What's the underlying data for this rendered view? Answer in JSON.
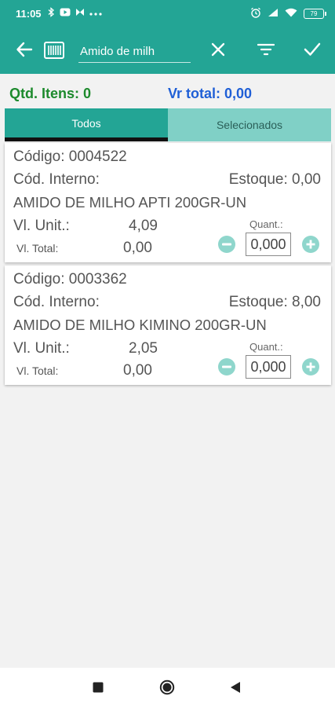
{
  "status_bar": {
    "time": "11:05",
    "left_icons": [
      "bluetooth-icon",
      "youtube-icon",
      "link-icon",
      "more-icon"
    ],
    "right_icons": [
      "alarm-icon",
      "signal-icon",
      "wifi-icon"
    ],
    "battery": "79"
  },
  "toolbar": {
    "search_value": "Amido de milh",
    "icons": [
      "back-arrow-icon",
      "barcode-icon",
      "clear-icon",
      "filter-icon",
      "check-icon"
    ],
    "background": "#23a595"
  },
  "summary": {
    "qtd_itens": "Qtd. Itens: 0",
    "vr_total": "Vr total: 0,00"
  },
  "tabs": [
    {
      "label": "Todos",
      "active": true
    },
    {
      "label": "Selecionados",
      "active": false
    }
  ],
  "products": [
    {
      "codigo": "Código: 0004522",
      "cod_interno": "Cód. Interno:",
      "estoque": "Estoque: 0,00",
      "descricao": "AMIDO DE MILHO APTI 200GR-UN",
      "vl_unit_label": "Vl. Unit.:",
      "vl_unit": "4,09",
      "vl_total_label": "Vl. Total:",
      "vl_total": "0,00",
      "quant_label": "Quant.:",
      "quant": "0,000"
    },
    {
      "codigo": "Código: 0003362",
      "cod_interno": "Cód. Interno:",
      "estoque": "Estoque: 8,00",
      "descricao": "AMIDO DE MILHO KIMINO 200GR-UN",
      "vl_unit_label": "Vl. Unit.:",
      "vl_unit": "2,05",
      "vl_total_label": "Vl. Total:",
      "vl_total": "0,00",
      "quant_label": "Quant.:",
      "quant": "0,000"
    }
  ],
  "nav": [
    "recents-square-icon",
    "home-circle-icon",
    "back-triangle-icon"
  ],
  "colors": {
    "primary": "#23a595",
    "tab_inactive": "#80d0c6",
    "qtd_green": "#1d8a2d",
    "total_blue": "#1f5fd6",
    "stepper": "#8fd6cc"
  }
}
